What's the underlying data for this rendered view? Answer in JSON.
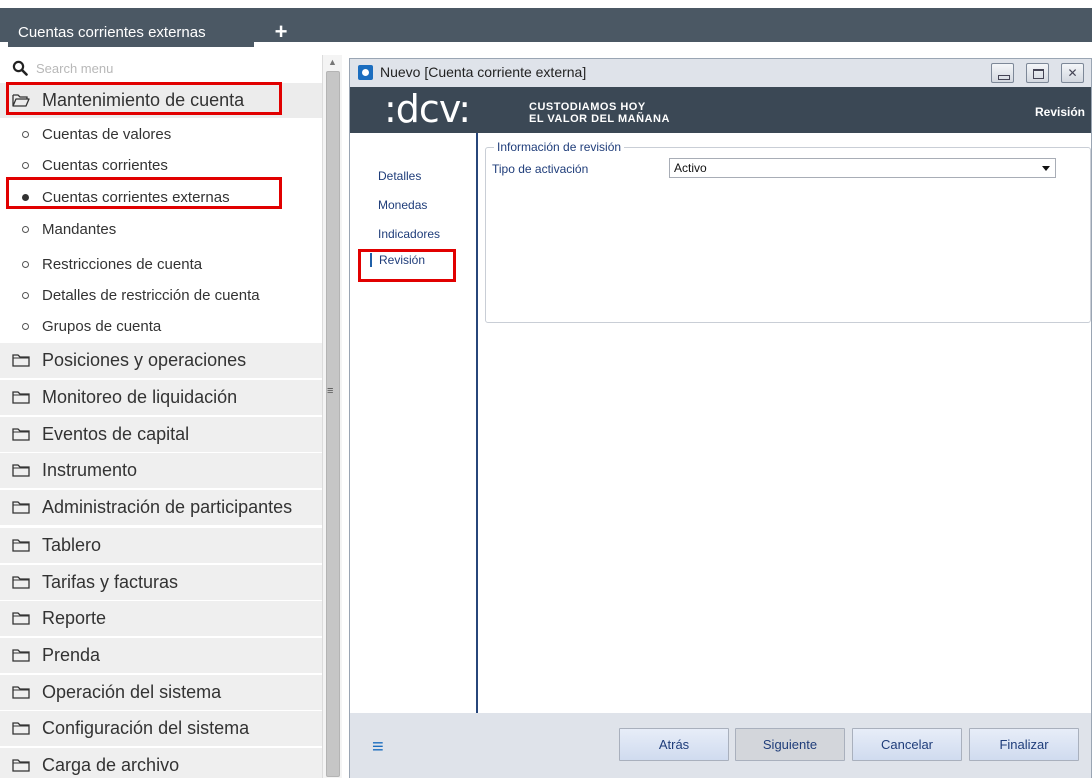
{
  "tabs": {
    "active_label": "Cuentas corrientes externas",
    "add_symbol": "+"
  },
  "search": {
    "placeholder": "Search menu",
    "value": ""
  },
  "menu": {
    "open_section": "Mantenimiento de cuenta",
    "sub_items": [
      {
        "label": "Cuentas de valores",
        "selected": false
      },
      {
        "label": "Cuentas corrientes",
        "selected": false
      },
      {
        "label": "Cuentas corrientes externas",
        "selected": true
      },
      {
        "label": "Mandantes",
        "selected": false
      },
      {
        "label": "Restricciones de cuenta",
        "selected": false
      },
      {
        "label": "Detalles de restricción de cuenta",
        "selected": false
      },
      {
        "label": "Grupos de cuenta",
        "selected": false
      }
    ],
    "sections": [
      "Posiciones y operaciones",
      "Monitoreo de liquidación",
      "Eventos de capital",
      "Instrumento",
      "Administración de participantes",
      "Tablero",
      "Tarifas y facturas",
      "Reporte",
      "Prenda",
      "Operación del sistema",
      "Configuración del sistema",
      "Carga de archivo"
    ]
  },
  "dialog": {
    "title": "Nuevo [Cuenta corriente externa]",
    "close_symbol": "✕",
    "banner": {
      "logo": ":dcv:",
      "tagline_1": "CUSTODIAMOS HOY",
      "tagline_2": "EL VALOR DEL MAÑANA",
      "current_step": "Revisión"
    },
    "steps": [
      "Detalles",
      "Monedas",
      "Indicadores",
      "Revisión"
    ],
    "active_step": "Revisión",
    "group_title": "Información de revisión",
    "field_label": "Tipo de activación",
    "field_value": "Activo",
    "footer": {
      "menu_symbol": "≡",
      "back": "Atrás",
      "next": "Siguiente",
      "cancel": "Cancelar",
      "finish": "Finalizar"
    }
  },
  "colors": {
    "highlight_box": "#e10000",
    "topbar": "#4b5864",
    "banner": "#3b4855",
    "link_text": "#1f3d7a",
    "accent": "#1b6dbf"
  }
}
